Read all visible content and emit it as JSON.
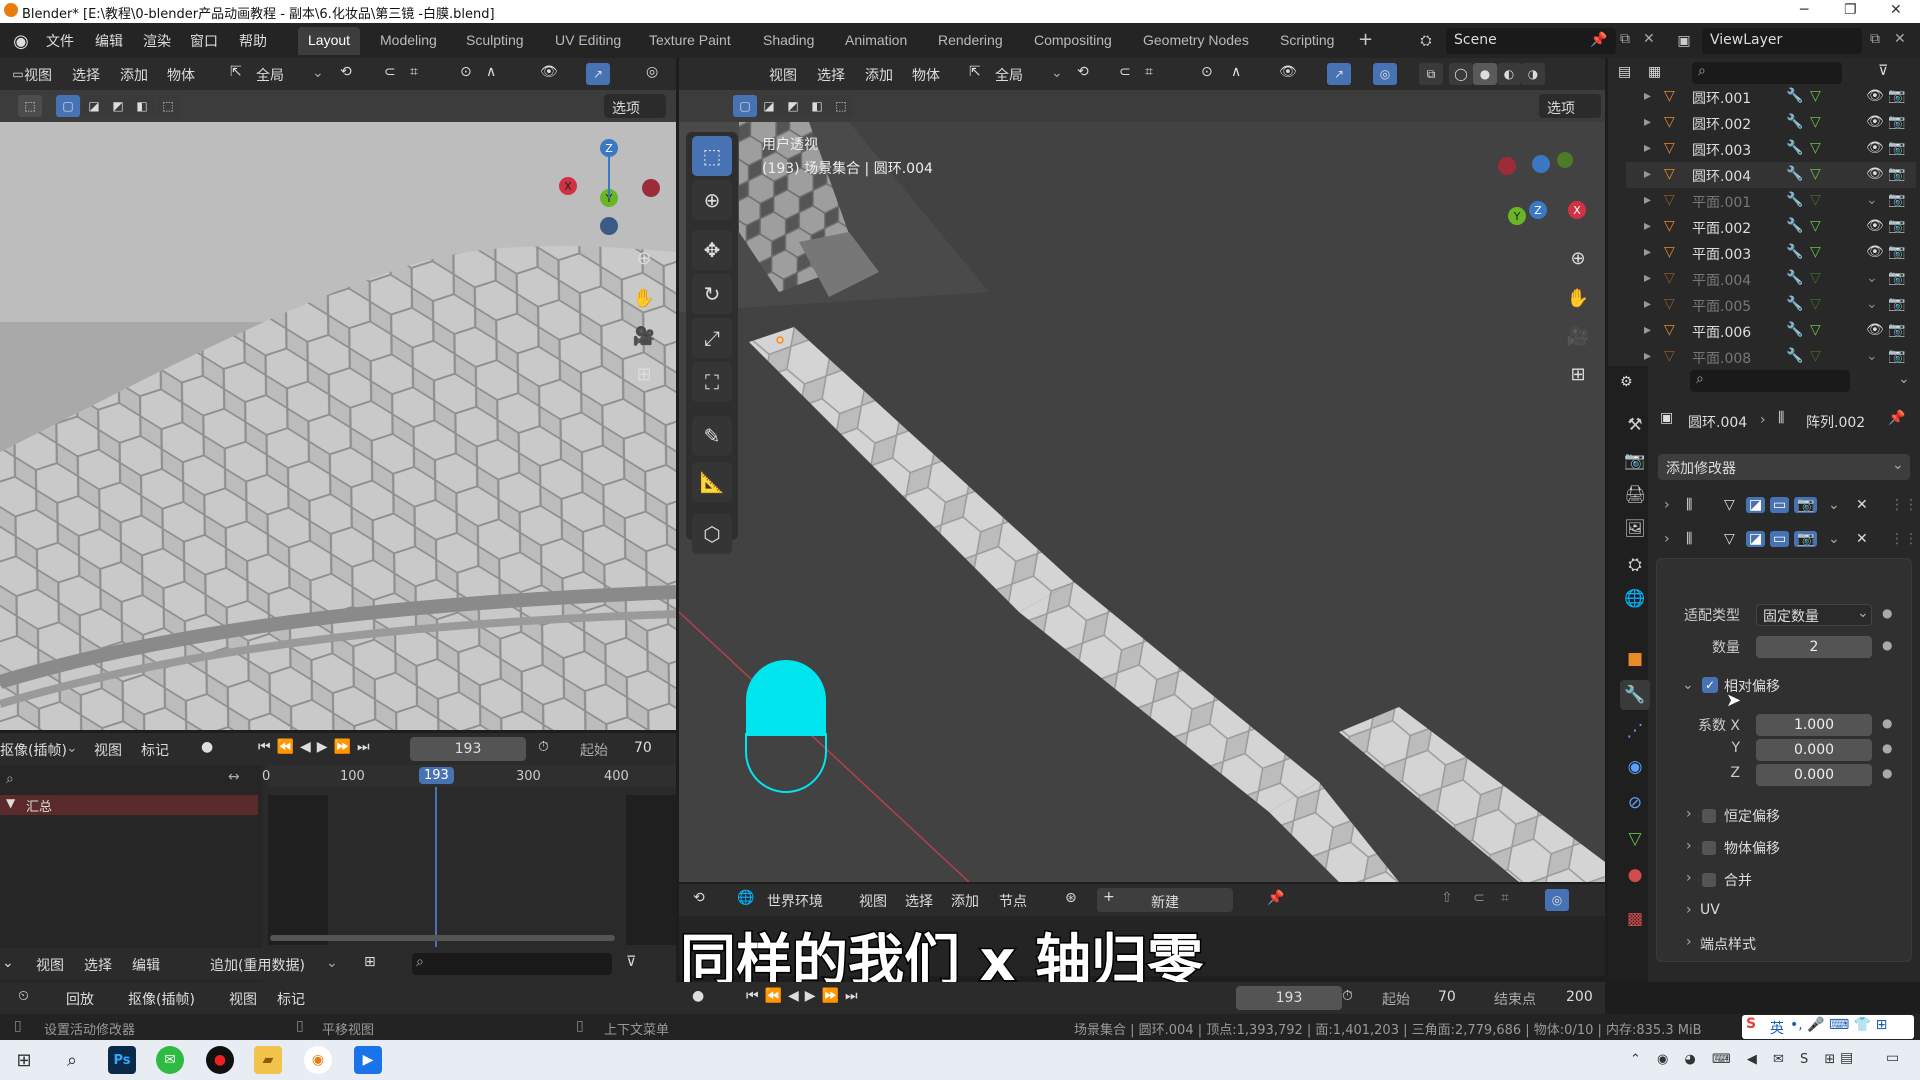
{
  "window": {
    "title": "Blender* [E:\\教程\\0-blender产品动画教程 - 副本\\6.化妆品\\第三镜 -白膜.blend]"
  },
  "menus": [
    "文件",
    "编辑",
    "渲染",
    "窗口",
    "帮助"
  ],
  "workspaces": [
    "Layout",
    "Modeling",
    "Sculpting",
    "UV Editing",
    "Texture Paint",
    "Shading",
    "Animation",
    "Rendering",
    "Compositing",
    "Geometry Nodes",
    "Scripting"
  ],
  "scene": {
    "name": "Scene",
    "view_layer": "ViewLayer"
  },
  "left_view": {
    "menus": [
      "视图",
      "选择",
      "添加",
      "物体"
    ],
    "orientation": "全局",
    "options": "选项"
  },
  "main_view": {
    "menus": [
      "视图",
      "选择",
      "添加",
      "物体"
    ],
    "orientation": "全局",
    "options": "选项",
    "info_title": "用户透视",
    "info_sub": "(193) 场景集合 | 圆环.004"
  },
  "timeline": {
    "mode": "抠像(插帧)",
    "menus": [
      "视图",
      "标记"
    ],
    "frame": "193",
    "start_label": "起始",
    "start": "70",
    "ticks": [
      "0",
      "100",
      "193",
      "300",
      "400"
    ],
    "summary": "汇总"
  },
  "editor_left_bottom": {
    "menus": [
      "视图",
      "选择",
      "编辑"
    ],
    "mode": "追加(重用数据)"
  },
  "playback_bar": {
    "items": [
      "回放",
      "抠像(插帧)",
      "视图",
      "标记"
    ],
    "frame": "193",
    "start_label": "起始",
    "start": "70",
    "end_label": "结束点",
    "end": "200"
  },
  "shader_bar": {
    "world": "世界环境",
    "menus": [
      "视图",
      "选择",
      "添加",
      "节点"
    ],
    "new_label": "新建"
  },
  "subtitle": "同样的我们 x 轴归零",
  "outliner": {
    "rows": [
      {
        "name": "圆环.001",
        "dim": false
      },
      {
        "name": "圆环.002",
        "dim": false
      },
      {
        "name": "圆环.003",
        "dim": false
      },
      {
        "name": "圆环.004",
        "dim": false
      },
      {
        "name": "平面.001",
        "dim": true
      },
      {
        "name": "平面.002",
        "dim": false
      },
      {
        "name": "平面.003",
        "dim": false
      },
      {
        "name": "平面.004",
        "dim": true
      },
      {
        "name": "平面.005",
        "dim": true
      },
      {
        "name": "平面.006",
        "dim": false
      },
      {
        "name": "平面.008",
        "dim": true
      }
    ]
  },
  "properties": {
    "breadcrumb_obj": "圆环.004",
    "breadcrumb_mod": "阵列.002",
    "add_modifier": "添加修改器",
    "fit_type_label": "适配类型",
    "fit_type_value": "固定数量",
    "count_label": "数量",
    "count_value": "2",
    "relative_offset": "相对偏移",
    "factor_x_label": "系数 X",
    "factor_x": "1.000",
    "y_label": "Y",
    "factor_y": "0.000",
    "z_label": "Z",
    "factor_z": "0.000",
    "sections": [
      "恒定偏移",
      "物体偏移",
      "合并",
      "UV",
      "端点样式"
    ]
  },
  "status_bar": {
    "left1": "设置活动修改器",
    "left2": "平移视图",
    "left3": "上下文菜单",
    "stats": "场景集合 | 圆环.004 | 顶点:1,393,792 | 面:1,401,203 | 三角面:2,779,686 | 物体:0/10 | 内存:835.3 MiB"
  },
  "ime": {
    "label": "英"
  },
  "colors": {
    "accent": "#4772b3",
    "active_tab": "#3d3d3d",
    "frame_marker": "#4772b3",
    "header": "#2b2b2b",
    "summary_row": "#5b2a2a",
    "cyan": "#00e5ee"
  }
}
